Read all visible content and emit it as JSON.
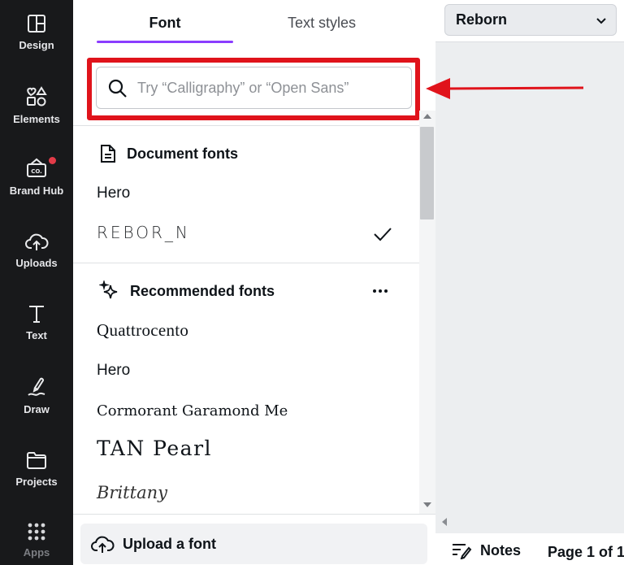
{
  "sidebar": {
    "items": [
      {
        "label": "Design",
        "icon": "layout-icon"
      },
      {
        "label": "Elements",
        "icon": "shapes-icon"
      },
      {
        "label": "Brand Hub",
        "icon": "brand-hub-icon"
      },
      {
        "label": "Uploads",
        "icon": "cloud-upload-icon"
      },
      {
        "label": "Text",
        "icon": "text-icon"
      },
      {
        "label": "Draw",
        "icon": "draw-icon"
      },
      {
        "label": "Projects",
        "icon": "folder-icon"
      },
      {
        "label": "Apps",
        "icon": "apps-grid-icon"
      }
    ]
  },
  "panel": {
    "tabs": [
      {
        "label": "Font",
        "active": true
      },
      {
        "label": "Text styles",
        "active": false
      }
    ],
    "search": {
      "placeholder": "Try “Calligraphy” or “Open Sans”",
      "value": ""
    },
    "document_fonts": {
      "title": "Document fonts",
      "fonts": [
        {
          "name": "Hero",
          "selected": false
        },
        {
          "name": "REBOR_N",
          "selected": true
        }
      ]
    },
    "recommended_fonts": {
      "title": "Recommended fonts",
      "fonts": [
        {
          "name": "Quattrocento"
        },
        {
          "name": "Hero"
        },
        {
          "name": "Cormorant Garamond Me"
        },
        {
          "name": "TAN Pearl"
        },
        {
          "name": "Brittany"
        }
      ]
    },
    "upload_button": {
      "label": "Upload a font"
    }
  },
  "toolbar": {
    "font_select": "Reborn"
  },
  "footer": {
    "notes_label": "Notes",
    "page_indicator": "Page 1 of 1"
  },
  "colors": {
    "sidebar_bg": "#18191b",
    "tab_accent": "#8b3dff",
    "annotation_red": "#e0131b"
  }
}
